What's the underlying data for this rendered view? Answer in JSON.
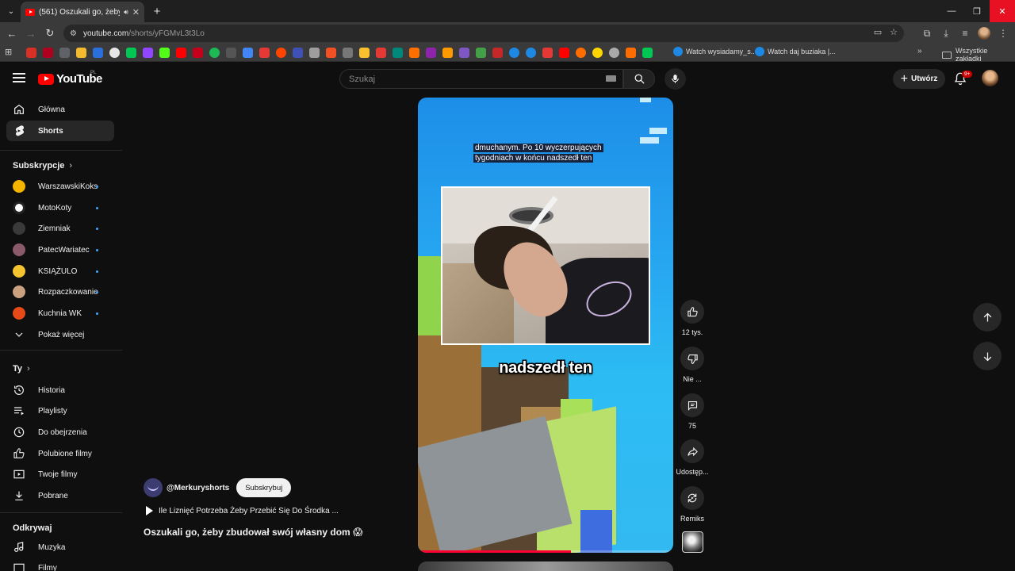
{
  "browser": {
    "tab_title": "(561) Oszukali go, żeby zbu",
    "url_host": "youtube.com",
    "url_path": "/shorts/yFGMvL3t3Lo",
    "bookmarks": {
      "named_1": "Watch wysiadamy_s...",
      "named_2": "Watch daj buziaka |...",
      "all_bookmarks": "Wszystkie zakładki"
    }
  },
  "masthead": {
    "logo_text": "YouTube",
    "country_code": "PL",
    "search_placeholder": "Szukaj",
    "create_label": "Utwórz",
    "notifications_badge": "9+"
  },
  "sidebar": {
    "main": [
      {
        "label": "Główna",
        "icon": "home-icon"
      },
      {
        "label": "Shorts",
        "icon": "shorts-icon",
        "active": true
      }
    ],
    "subscriptions_title": "Subskrypcje",
    "subscriptions": [
      {
        "label": "WarszawskiKoks",
        "color": "#f4b400"
      },
      {
        "label": "MotoKoty",
        "color": "#ffffff"
      },
      {
        "label": "Ziemniak",
        "color": "#3a3a3a"
      },
      {
        "label": "PatecWariatec",
        "color": "#8a5a6a"
      },
      {
        "label": "KSIĄŻULO",
        "color": "#f4c430"
      },
      {
        "label": "Rozpaczkowanie",
        "color": "#c9a080"
      },
      {
        "label": "Kuchnia WK",
        "color": "#e64a19"
      }
    ],
    "show_more": "Pokaż więcej",
    "you_title": "Ty",
    "you": [
      {
        "label": "Historia",
        "icon": "history-icon"
      },
      {
        "label": "Playlisty",
        "icon": "playlist-icon"
      },
      {
        "label": "Do obejrzenia",
        "icon": "watch-later-icon"
      },
      {
        "label": "Polubione filmy",
        "icon": "liked-icon"
      },
      {
        "label": "Twoje filmy",
        "icon": "your-videos-icon"
      },
      {
        "label": "Pobrane",
        "icon": "download-icon"
      }
    ],
    "explore_title": "Odkrywaj",
    "explore": [
      {
        "label": "Muzyka",
        "icon": "music-icon"
      },
      {
        "label": "Filmy",
        "icon": "films-icon"
      }
    ]
  },
  "short": {
    "subtitle_top_line1": "dmuchanym. Po 10 wyczerpujących",
    "subtitle_top_line2": "tygodniach w końcu nadszedł ten",
    "caption": "nadszedł ten",
    "progress": 0.6,
    "channel": "@Merkuryshorts",
    "subscribe": "Subskrybuj",
    "sound": "Ile Liznięć Potrzeba Żeby Przebić Się Do Środka ...",
    "title": "Oszukali go, żeby zbudował swój własny dom 😱",
    "actions": {
      "likes": "12 tys.",
      "dislike": "Nie ...",
      "comments": "75",
      "share": "Udostęp...",
      "remix": "Remiks"
    }
  }
}
